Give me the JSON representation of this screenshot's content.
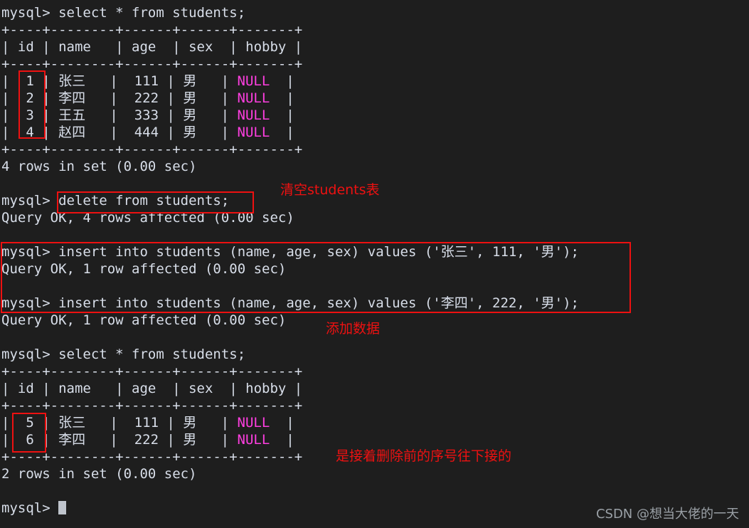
{
  "terminal": {
    "background_color": "#1e1e1e",
    "foreground_color": "#d8dee9",
    "null_color": "#ff3fe0",
    "annotation_color": "#ee1111",
    "prompt": "mysql>",
    "lines": [
      {
        "id": "l01",
        "text": "mysql> select * from students;"
      },
      {
        "id": "l02",
        "text": "+----+--------+------+------+-------+"
      },
      {
        "id": "l03",
        "text": "| id | name   | age  | sex  | hobby |"
      },
      {
        "id": "l04",
        "text": "+----+--------+------+------+-------+"
      },
      {
        "id": "l05",
        "text": "|  1 | 张三   |  111 | 男   | NULL  |"
      },
      {
        "id": "l06",
        "text": "|  2 | 李四   |  222 | 男   | NULL  |"
      },
      {
        "id": "l07",
        "text": "|  3 | 王五   |  333 | 男   | NULL  |"
      },
      {
        "id": "l08",
        "text": "|  4 | 赵四   |  444 | 男   | NULL  |"
      },
      {
        "id": "l09",
        "text": "+----+--------+------+------+-------+"
      },
      {
        "id": "l10",
        "text": "4 rows in set (0.00 sec)"
      },
      {
        "id": "l11",
        "text": ""
      },
      {
        "id": "l12",
        "text": "mysql> delete from students;"
      },
      {
        "id": "l13",
        "text": "Query OK, 4 rows affected (0.00 sec)"
      },
      {
        "id": "l14",
        "text": ""
      },
      {
        "id": "l15",
        "text": "mysql> insert into students (name, age, sex) values ('张三', 111, '男');"
      },
      {
        "id": "l16",
        "text": "Query OK, 1 row affected (0.00 sec)"
      },
      {
        "id": "l17",
        "text": ""
      },
      {
        "id": "l18",
        "text": "mysql> insert into students (name, age, sex) values ('李四', 222, '男');"
      },
      {
        "id": "l19",
        "text": "Query OK, 1 row affected (0.00 sec)"
      },
      {
        "id": "l20",
        "text": ""
      },
      {
        "id": "l21",
        "text": "mysql> select * from students;"
      },
      {
        "id": "l22",
        "text": "+----+--------+------+------+-------+"
      },
      {
        "id": "l23",
        "text": "| id | name   | age  | sex  | hobby |"
      },
      {
        "id": "l24",
        "text": "+----+--------+------+------+-------+"
      },
      {
        "id": "l25",
        "text": "|  5 | 张三   |  111 | 男   | NULL  |"
      },
      {
        "id": "l26",
        "text": "|  6 | 李四   |  222 | 男   | NULL  |"
      },
      {
        "id": "l27",
        "text": "+----+--------+------+------+-------+"
      },
      {
        "id": "l28",
        "text": "2 rows in set (0.00 sec)"
      },
      {
        "id": "l29",
        "text": ""
      },
      {
        "id": "l30",
        "text": "mysql> "
      }
    ]
  },
  "result_table_1": {
    "columns": [
      "id",
      "name",
      "age",
      "sex",
      "hobby"
    ],
    "rows": [
      [
        "1",
        "张三",
        "111",
        "男",
        "NULL"
      ],
      [
        "2",
        "李四",
        "222",
        "男",
        "NULL"
      ],
      [
        "3",
        "王五",
        "333",
        "男",
        "NULL"
      ],
      [
        "4",
        "赵四",
        "444",
        "男",
        "NULL"
      ]
    ],
    "footer": "4 rows in set (0.00 sec)"
  },
  "result_table_2": {
    "columns": [
      "id",
      "name",
      "age",
      "sex",
      "hobby"
    ],
    "rows": [
      [
        "5",
        "张三",
        "111",
        "男",
        "NULL"
      ],
      [
        "6",
        "李四",
        "222",
        "男",
        "NULL"
      ]
    ],
    "footer": "2 rows in set (0.00 sec)"
  },
  "annotations": {
    "clear_table": "清空students表",
    "add_data": "添加数据",
    "sequence_note": "是接着删除前的序号往下接的"
  },
  "watermark": "CSDN @想当大佬的一天"
}
